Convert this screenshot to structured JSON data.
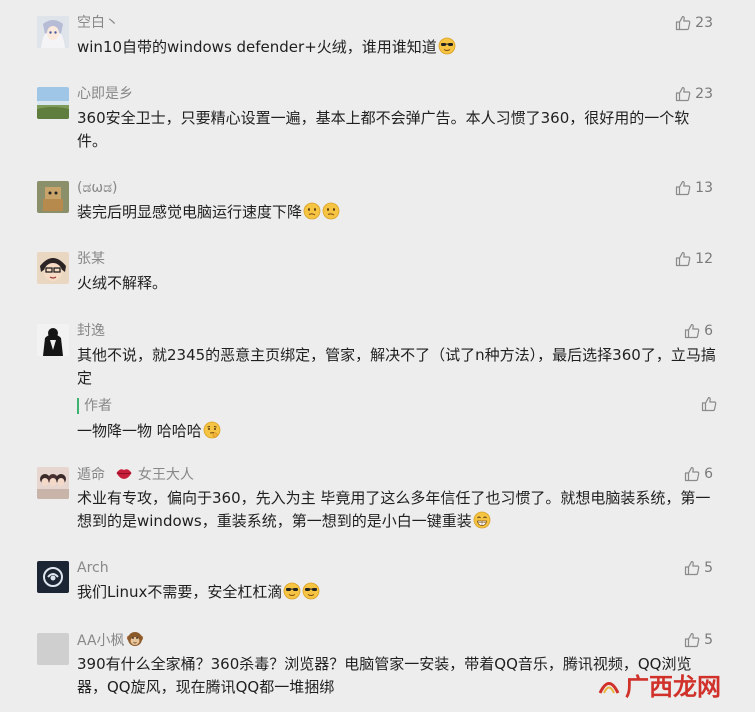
{
  "comments": [
    {
      "nick": "空白丶",
      "text": "win10自带的windows defender+火绒，谁用谁知道",
      "likes": "23"
    },
    {
      "nick": "心即是乡",
      "text": "360安全卫士，只要精心设置一遍，基本上都不会弹广告。本人习惯了360，很好用的一个软件。",
      "likes": "23"
    },
    {
      "nick": "(ಡωಡ)",
      "text": "装完后明显感觉电脑运行速度下降",
      "likes": "13"
    },
    {
      "nick": "张某",
      "text": "火绒不解释。",
      "likes": "12"
    },
    {
      "nick": "封逸",
      "text": "其他不说，就2345的恶意主页绑定，管家，解决不了（试了n种方法），最后选择360了，立马搞定",
      "likes": "6",
      "reply": {
        "author": "作者",
        "text": "一物降一物 哈哈哈"
      }
    },
    {
      "nick": "遁命",
      "nick_suffix": "女王大人",
      "text": "术业有专攻，偏向于360，先入为主 毕竟用了这么多年信任了也习惯了。就想电脑装系统，第一想到的是windows，重装系统，第一想到的是小白一键重装",
      "likes": "6"
    },
    {
      "nick": "Arch",
      "text": "我们Linux不需要，安全杠杠滴",
      "likes": "5"
    },
    {
      "nick": "AA小枫",
      "text": "390有什么全家桶？360杀毒？浏览器？电脑管家一安装，带着QQ音乐，腾讯视频，QQ浏览器，QQ旋风，现在腾讯QQ都一堆捆绑",
      "likes": "5"
    }
  ],
  "watermark": "广西龙网",
  "colors": {
    "background": "#ededed",
    "reply_bar": "#3cb371",
    "watermark": "#d0322b"
  }
}
